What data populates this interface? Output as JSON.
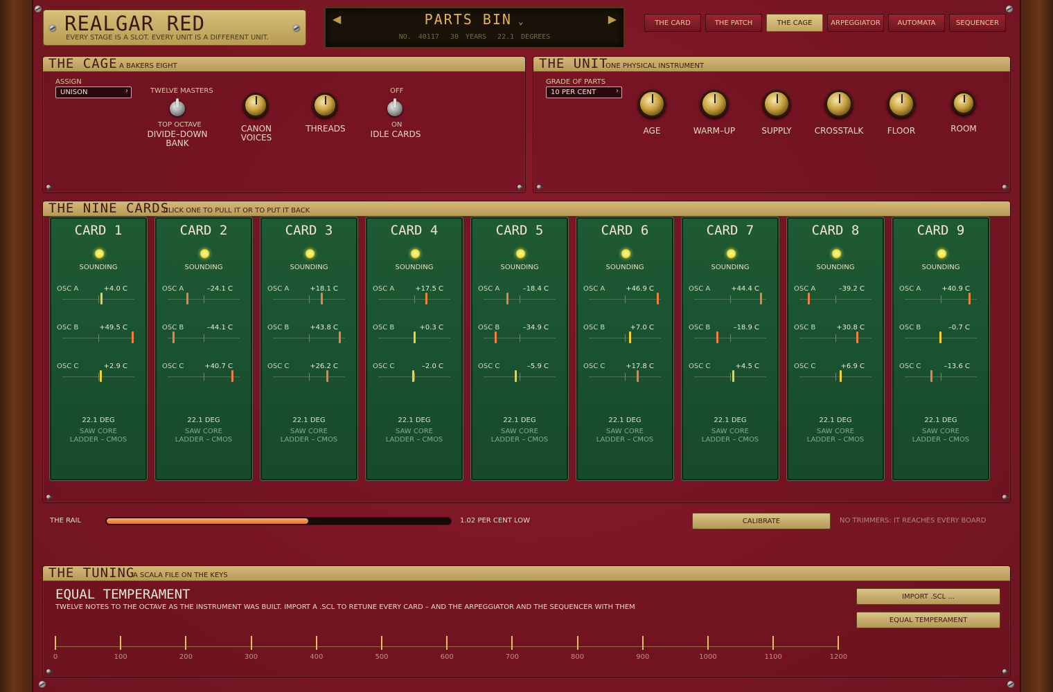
{
  "brand": {
    "title": "REALGAR RED",
    "subtitle": "EVERY STAGE IS A SLOT. EVERY UNIT IS A DIFFERENT UNIT."
  },
  "display": {
    "patch_name": "PARTS BIN",
    "number": "NO. 40117",
    "years": "30 YEARS",
    "degrees": "22.1 DEGREES"
  },
  "tabs": [
    {
      "label": "THE CARD",
      "active": false
    },
    {
      "label": "THE PATCH",
      "active": false
    },
    {
      "label": "THE CAGE",
      "active": true
    },
    {
      "label": "ARPEGGIATOR",
      "active": false
    },
    {
      "label": "AUTOMATA",
      "active": false
    },
    {
      "label": "SEQUENCER",
      "active": false
    }
  ],
  "cage": {
    "title": "THE CAGE",
    "subtitle": "A BAKERS EIGHT",
    "assign_label": "ASSIGN",
    "assign_value": "UNISON",
    "twelve_masters": "TWELVE MASTERS",
    "top_octave": "TOP OCTAVE",
    "divide_down": "DIVIDE–DOWN",
    "bank": "BANK",
    "canon_voices": "CANON",
    "canon_voices2": "VOICES",
    "threads": "THREADS",
    "off": "OFF",
    "on": "ON",
    "idle_cards": "IDLE CARDS"
  },
  "unit": {
    "title": "THE UNIT",
    "subtitle": "ONE PHYSICAL INSTRUMENT",
    "grade_label": "GRADE OF PARTS",
    "grade_value": "10 PER CENT",
    "knobs": [
      "AGE",
      "WARM–UP",
      "SUPPLY",
      "CROSSTALK",
      "FLOOR",
      "ROOM"
    ]
  },
  "nine_cards": {
    "title": "THE NINE CARDS",
    "subtitle": "CLICK ONE TO PULL IT OR TO PUT IT BACK",
    "cards": [
      {
        "name": "CARD 1",
        "status": "SOUNDING",
        "osc": [
          {
            "n": "OSC A",
            "v": "+4.0 C",
            "c": 4.0
          },
          {
            "n": "OSC B",
            "v": "+49.5 C",
            "c": 49.5
          },
          {
            "n": "OSC C",
            "v": "+2.9 C",
            "c": 2.9
          }
        ],
        "deg": "22.1 DEG",
        "core1": "SAW CORE",
        "core2": "LADDER – CMOS"
      },
      {
        "name": "CARD 2",
        "status": "SOUNDING",
        "osc": [
          {
            "n": "OSC A",
            "v": "–24.1 C",
            "c": -24.1
          },
          {
            "n": "OSC B",
            "v": "–44.1 C",
            "c": -44.1
          },
          {
            "n": "OSC C",
            "v": "+40.7 C",
            "c": 40.7
          }
        ],
        "deg": "22.1 DEG",
        "core1": "SAW CORE",
        "core2": "LADDER – CMOS"
      },
      {
        "name": "CARD 3",
        "status": "SOUNDING",
        "osc": [
          {
            "n": "OSC A",
            "v": "+18.1 C",
            "c": 18.1
          },
          {
            "n": "OSC B",
            "v": "+43.8 C",
            "c": 43.8
          },
          {
            "n": "OSC C",
            "v": "+26.2 C",
            "c": 26.2
          }
        ],
        "deg": "22.1 DEG",
        "core1": "SAW CORE",
        "core2": "LADDER – CMOS"
      },
      {
        "name": "CARD 4",
        "status": "SOUNDING",
        "osc": [
          {
            "n": "OSC A",
            "v": "+17.5 C",
            "c": 17.5
          },
          {
            "n": "OSC B",
            "v": "+0.3 C",
            "c": 0.3
          },
          {
            "n": "OSC C",
            "v": "–2.0 C",
            "c": -2.0
          }
        ],
        "deg": "22.1 DEG",
        "core1": "SAW CORE",
        "core2": "LADDER – CMOS"
      },
      {
        "name": "CARD 5",
        "status": "SOUNDING",
        "osc": [
          {
            "n": "OSC A",
            "v": "–18.4 C",
            "c": -18.4
          },
          {
            "n": "OSC B",
            "v": "–34.9 C",
            "c": -34.9
          },
          {
            "n": "OSC C",
            "v": "–5.9 C",
            "c": -5.9
          }
        ],
        "deg": "22.1 DEG",
        "core1": "SAW CORE",
        "core2": "LADDER – CMOS"
      },
      {
        "name": "CARD 6",
        "status": "SOUNDING",
        "osc": [
          {
            "n": "OSC A",
            "v": "+46.9 C",
            "c": 46.9
          },
          {
            "n": "OSC B",
            "v": "+7.0 C",
            "c": 7.0
          },
          {
            "n": "OSC C",
            "v": "+17.8 C",
            "c": 17.8
          }
        ],
        "deg": "22.1 DEG",
        "core1": "SAW CORE",
        "core2": "LADDER – CMOS"
      },
      {
        "name": "CARD 7",
        "status": "SOUNDING",
        "osc": [
          {
            "n": "OSC A",
            "v": "+44.4 C",
            "c": 44.4
          },
          {
            "n": "OSC B",
            "v": "–18.9 C",
            "c": -18.9
          },
          {
            "n": "OSC C",
            "v": "+4.5 C",
            "c": 4.5
          }
        ],
        "deg": "22.1 DEG",
        "core1": "SAW CORE",
        "core2": "LADDER – CMOS"
      },
      {
        "name": "CARD 8",
        "status": "SOUNDING",
        "osc": [
          {
            "n": "OSC A",
            "v": "–39.2 C",
            "c": -39.2
          },
          {
            "n": "OSC B",
            "v": "+30.8 C",
            "c": 30.8
          },
          {
            "n": "OSC C",
            "v": "+6.9 C",
            "c": 6.9
          }
        ],
        "deg": "22.1 DEG",
        "core1": "SAW CORE",
        "core2": "LADDER – CMOS"
      },
      {
        "name": "CARD 9",
        "status": "SOUNDING",
        "osc": [
          {
            "n": "OSC A",
            "v": "+40.9 C",
            "c": 40.9
          },
          {
            "n": "OSC B",
            "v": "–0.7 C",
            "c": -0.7
          },
          {
            "n": "OSC C",
            "v": "–13.6 C",
            "c": -13.6
          }
        ],
        "deg": "22.1 DEG",
        "core1": "SAW CORE",
        "core2": "LADDER – CMOS"
      }
    ]
  },
  "rail": {
    "label": "THE RAIL",
    "value_text": "1.02 PER CENT LOW",
    "fill_fraction": 0.59,
    "calibrate": "CALIBRATE",
    "note": "NO TRIMMERS: IT REACHES EVERY BOARD"
  },
  "tuning": {
    "title": "THE TUNING",
    "subtitle": "A SCALA FILE ON THE KEYS",
    "name": "EQUAL TEMPERAMENT",
    "desc": "TWELVE NOTES TO THE OCTAVE AS THE INSTRUMENT WAS BUILT.  IMPORT A .SCL TO RETUNE EVERY CARD – AND THE ARPEGGIATOR AND THE SEQUENCER WITH THEM",
    "import_btn": "IMPORT .SCL ...",
    "equal_btn": "EQUAL TEMPERAMENT",
    "ticks": [
      "0",
      "100",
      "200",
      "300",
      "400",
      "500",
      "600",
      "700",
      "800",
      "900",
      "1000",
      "1100",
      "1200"
    ]
  },
  "colors": {
    "accent": "#e0c888",
    "card_green": "#1e5a34",
    "led": "#f4e040",
    "rail_fill": "#f09050"
  }
}
